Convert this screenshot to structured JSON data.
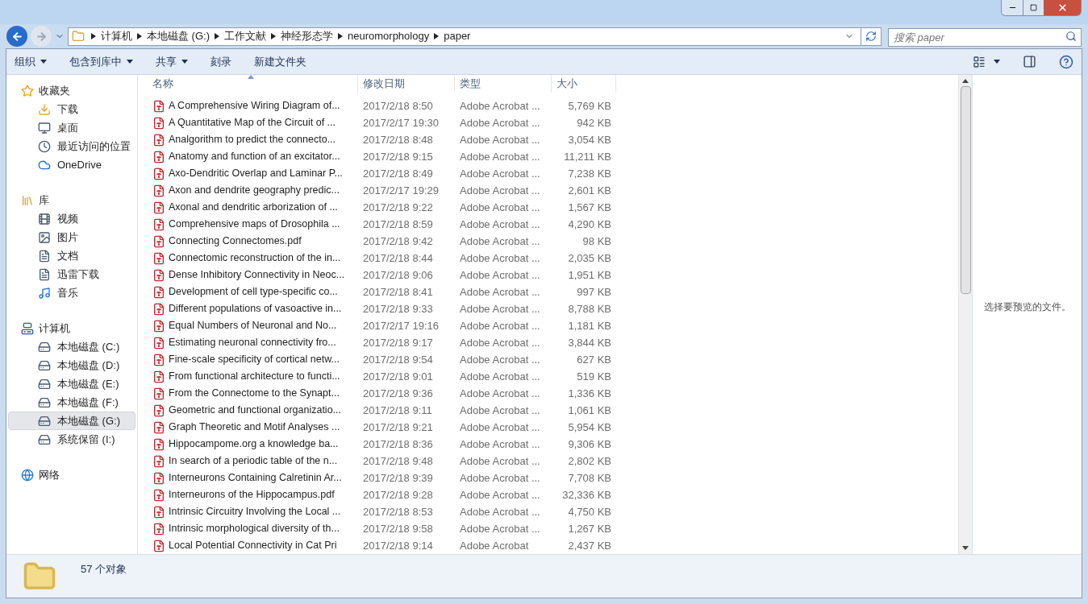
{
  "address_bar": {
    "crumbs": [
      "计算机",
      "本地磁盘 (G:)",
      "工作文献",
      "神经形态学",
      "neuromorphology",
      "paper"
    ]
  },
  "search": {
    "placeholder": "搜索 paper"
  },
  "toolbar": [
    {
      "label": "组织",
      "has_menu": true
    },
    {
      "label": "包含到库中",
      "has_menu": true
    },
    {
      "label": "共享",
      "has_menu": true
    },
    {
      "label": "刻录",
      "has_menu": false
    },
    {
      "label": "新建文件夹",
      "has_menu": false
    }
  ],
  "sidebar": [
    {
      "label": "收藏夹",
      "kind": "star",
      "selected": false,
      "children": [
        {
          "label": "下载",
          "kind": "download",
          "selected": false
        },
        {
          "label": "桌面",
          "kind": "desktop",
          "selected": false
        },
        {
          "label": "最近访问的位置",
          "kind": "recent",
          "selected": false
        },
        {
          "label": "OneDrive",
          "kind": "cloud",
          "selected": false
        }
      ]
    },
    {
      "label": "库",
      "kind": "library",
      "selected": false,
      "children": [
        {
          "label": "视频",
          "kind": "video",
          "selected": false
        },
        {
          "label": "图片",
          "kind": "picture",
          "selected": false
        },
        {
          "label": "文档",
          "kind": "document",
          "selected": false
        },
        {
          "label": "迅雷下载",
          "kind": "document",
          "selected": false
        },
        {
          "label": "音乐",
          "kind": "music",
          "selected": false
        }
      ]
    },
    {
      "label": "计算机",
      "kind": "computer",
      "selected": false,
      "children": [
        {
          "label": "本地磁盘 (C:)",
          "kind": "drive",
          "selected": false
        },
        {
          "label": "本地磁盘 (D:)",
          "kind": "drive",
          "selected": false
        },
        {
          "label": "本地磁盘 (E:)",
          "kind": "drive",
          "selected": false
        },
        {
          "label": "本地磁盘 (F:)",
          "kind": "drive",
          "selected": false
        },
        {
          "label": "本地磁盘 (G:)",
          "kind": "drive",
          "selected": true
        },
        {
          "label": "系统保留 (I:)",
          "kind": "drive",
          "selected": false
        }
      ]
    },
    {
      "label": "网络",
      "kind": "network",
      "selected": false
    }
  ],
  "table": {
    "columns": [
      {
        "label": "名称",
        "sorted": true
      },
      {
        "label": "修改日期",
        "sorted": false
      },
      {
        "label": "类型",
        "sorted": false
      },
      {
        "label": "大小",
        "sorted": false
      }
    ],
    "rows": [
      {
        "name": "A Comprehensive Wiring Diagram of...",
        "date": "2017/2/18 8:50",
        "type": "Adobe Acrobat ...",
        "size": "5,769 KB"
      },
      {
        "name": "A Quantitative Map of the Circuit of ...",
        "date": "2017/2/17 19:30",
        "type": "Adobe Acrobat ...",
        "size": "942 KB"
      },
      {
        "name": "Analgorithm to predict the connecto...",
        "date": "2017/2/18 8:48",
        "type": "Adobe Acrobat ...",
        "size": "3,054 KB"
      },
      {
        "name": "Anatomy and function of an excitator...",
        "date": "2017/2/18 9:15",
        "type": "Adobe Acrobat ...",
        "size": "11,211 KB"
      },
      {
        "name": "Axo-Dendritic Overlap and Laminar P...",
        "date": "2017/2/18 8:49",
        "type": "Adobe Acrobat ...",
        "size": "7,238 KB"
      },
      {
        "name": "Axon and dendrite geography predic...",
        "date": "2017/2/17 19:29",
        "type": "Adobe Acrobat ...",
        "size": "2,601 KB"
      },
      {
        "name": "Axonal and dendritic arborization of ...",
        "date": "2017/2/18 9:22",
        "type": "Adobe Acrobat ...",
        "size": "1,567 KB"
      },
      {
        "name": "Comprehensive maps of Drosophila ...",
        "date": "2017/2/18 8:59",
        "type": "Adobe Acrobat ...",
        "size": "4,290 KB"
      },
      {
        "name": "Connecting Connectomes.pdf",
        "date": "2017/2/18 9:42",
        "type": "Adobe Acrobat ...",
        "size": "98 KB"
      },
      {
        "name": "Connectomic reconstruction of the in...",
        "date": "2017/2/18 8:44",
        "type": "Adobe Acrobat ...",
        "size": "2,035 KB"
      },
      {
        "name": "Dense Inhibitory Connectivity in Neoc...",
        "date": "2017/2/18 9:06",
        "type": "Adobe Acrobat ...",
        "size": "1,951 KB"
      },
      {
        "name": "Development of cell type-specific co...",
        "date": "2017/2/18 8:41",
        "type": "Adobe Acrobat ...",
        "size": "997 KB"
      },
      {
        "name": "Different populations of vasoactive in...",
        "date": "2017/2/18 9:33",
        "type": "Adobe Acrobat ...",
        "size": "8,788 KB"
      },
      {
        "name": "Equal Numbers of Neuronal and No...",
        "date": "2017/2/17 19:16",
        "type": "Adobe Acrobat ...",
        "size": "1,181 KB"
      },
      {
        "name": "Estimating neuronal connectivity fro...",
        "date": "2017/2/18 9:17",
        "type": "Adobe Acrobat ...",
        "size": "3,844 KB"
      },
      {
        "name": "Fine-scale specificity of cortical netw...",
        "date": "2017/2/18 9:54",
        "type": "Adobe Acrobat ...",
        "size": "627 KB"
      },
      {
        "name": "From functional architecture to functi...",
        "date": "2017/2/18 9:01",
        "type": "Adobe Acrobat ...",
        "size": "519 KB"
      },
      {
        "name": "From the Connectome to the Synapt...",
        "date": "2017/2/18 9:36",
        "type": "Adobe Acrobat ...",
        "size": "1,336 KB"
      },
      {
        "name": "Geometric and functional organizatio...",
        "date": "2017/2/18 9:11",
        "type": "Adobe Acrobat ...",
        "size": "1,061 KB"
      },
      {
        "name": "Graph Theoretic and Motif Analyses ...",
        "date": "2017/2/18 9:21",
        "type": "Adobe Acrobat ...",
        "size": "5,954 KB"
      },
      {
        "name": "Hippocampome.org a knowledge ba...",
        "date": "2017/2/18 8:36",
        "type": "Adobe Acrobat ...",
        "size": "9,306 KB"
      },
      {
        "name": "In search of a periodic table of the n...",
        "date": "2017/2/18 9:48",
        "type": "Adobe Acrobat ...",
        "size": "2,802 KB"
      },
      {
        "name": "Interneurons Containing Calretinin Ar...",
        "date": "2017/2/18 9:39",
        "type": "Adobe Acrobat ...",
        "size": "7,708 KB"
      },
      {
        "name": "Interneurons of the Hippocampus.pdf",
        "date": "2017/2/18 9:28",
        "type": "Adobe Acrobat ...",
        "size": "32,336 KB"
      },
      {
        "name": "Intrinsic Circuitry Involving the Local ...",
        "date": "2017/2/18 8:53",
        "type": "Adobe Acrobat ...",
        "size": "4,750 KB"
      },
      {
        "name": "Intrinsic morphological diversity of th...",
        "date": "2017/2/18 9:58",
        "type": "Adobe Acrobat ...",
        "size": "1,267 KB"
      },
      {
        "name": "Local Potential Connectivity in Cat Pri",
        "date": "2017/2/18 9:14",
        "type": "Adobe Acrobat",
        "size": "2,437 KB"
      }
    ]
  },
  "preview": {
    "message": "选择要预览的文件。"
  },
  "status_bar": {
    "count": "57 个对象"
  }
}
